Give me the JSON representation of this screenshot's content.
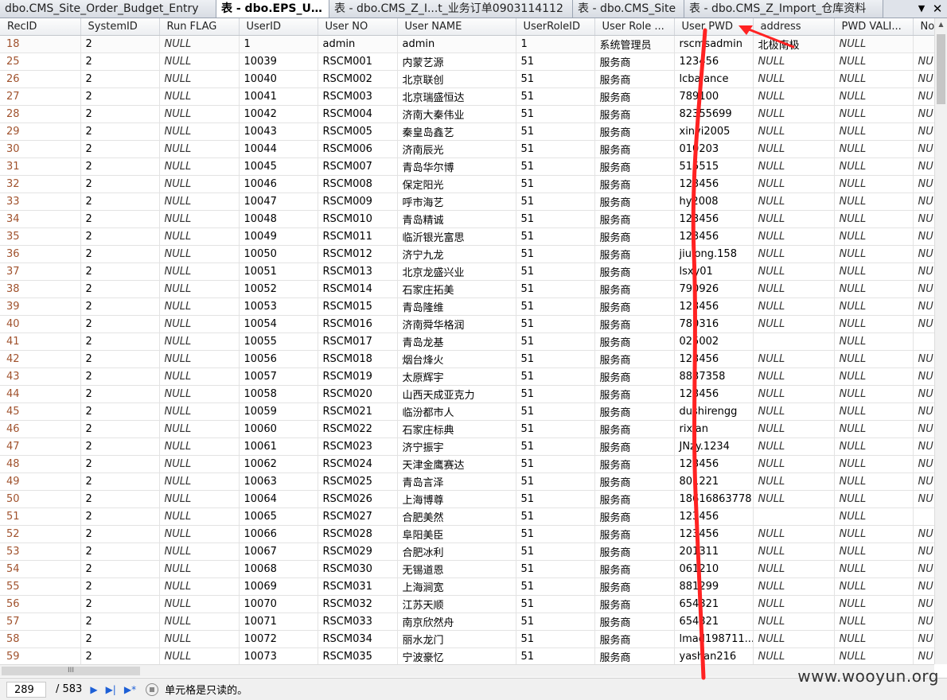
{
  "tabs": [
    {
      "label": "dbo.CMS_Site_Order_Budget_Entry"
    },
    {
      "label": "表 - dbo.EPS_User"
    },
    {
      "label": "表 - dbo.CMS_Z_I...t_业务订单0903114112"
    },
    {
      "label": "表 - dbo.CMS_Site"
    },
    {
      "label": "表 - dbo.CMS_Z_Import_仓库资料"
    }
  ],
  "tab_menu_icon": "▼",
  "tab_close_icon": "✕",
  "columns": [
    "RecID",
    "SystemID",
    "Run  FLAG",
    "UserID",
    "User  NO",
    "User  NAME",
    "UserRoleID",
    "User  Role  ...",
    "User  PWD",
    "address",
    "PWD  VALI...",
    "No"
  ],
  "rows": [
    [
      "18",
      "2",
      "NULL",
      "1",
      "admin",
      "admin",
      "1",
      "系统管理员",
      "rscmsadmin",
      "北极南极",
      "NULL",
      ""
    ],
    [
      "25",
      "2",
      "NULL",
      "10039",
      "RSCM001",
      "内蒙艺源",
      "51",
      "服务商",
      "123456",
      "NULL",
      "NULL",
      "NU"
    ],
    [
      "26",
      "2",
      "NULL",
      "10040",
      "RSCM002",
      "北京联创",
      "51",
      "服务商",
      "lcbalance",
      "NULL",
      "NULL",
      "NU"
    ],
    [
      "27",
      "2",
      "NULL",
      "10041",
      "RSCM003",
      "北京瑞盛恒达",
      "51",
      "服务商",
      "789100",
      "NULL",
      "NULL",
      "NU"
    ],
    [
      "28",
      "2",
      "NULL",
      "10042",
      "RSCM004",
      "济南大秦伟业",
      "51",
      "服务商",
      "82355699",
      "NULL",
      "NULL",
      "NU"
    ],
    [
      "29",
      "2",
      "NULL",
      "10043",
      "RSCM005",
      "秦皇岛鑫艺",
      "51",
      "服务商",
      "xinyi2005",
      "NULL",
      "NULL",
      "NU"
    ],
    [
      "30",
      "2",
      "NULL",
      "10044",
      "RSCM006",
      "济南辰光",
      "51",
      "服务商",
      "010203",
      "NULL",
      "NULL",
      "NU"
    ],
    [
      "31",
      "2",
      "NULL",
      "10045",
      "RSCM007",
      "青岛华尔博",
      "51",
      "服务商",
      "515515",
      "NULL",
      "NULL",
      "NU"
    ],
    [
      "32",
      "2",
      "NULL",
      "10046",
      "RSCM008",
      "保定阳光",
      "51",
      "服务商",
      "123456",
      "NULL",
      "NULL",
      "NU"
    ],
    [
      "33",
      "2",
      "NULL",
      "10047",
      "RSCM009",
      "呼市海艺",
      "51",
      "服务商",
      "hy2008",
      "NULL",
      "NULL",
      "NU"
    ],
    [
      "34",
      "2",
      "NULL",
      "10048",
      "RSCM010",
      "青岛精诚",
      "51",
      "服务商",
      "123456",
      "NULL",
      "NULL",
      "NU"
    ],
    [
      "35",
      "2",
      "NULL",
      "10049",
      "RSCM011",
      "临沂银光富思",
      "51",
      "服务商",
      "123456",
      "NULL",
      "NULL",
      "NU"
    ],
    [
      "36",
      "2",
      "NULL",
      "10050",
      "RSCM012",
      "济宁九龙",
      "51",
      "服务商",
      "jiulong.158",
      "NULL",
      "NULL",
      "NU"
    ],
    [
      "37",
      "2",
      "NULL",
      "10051",
      "RSCM013",
      "北京龙盛兴业",
      "51",
      "服务商",
      "lsxy01",
      "NULL",
      "NULL",
      "NU"
    ],
    [
      "38",
      "2",
      "NULL",
      "10052",
      "RSCM014",
      "石家庄拓美",
      "51",
      "服务商",
      "790926",
      "NULL",
      "NULL",
      "NU"
    ],
    [
      "39",
      "2",
      "NULL",
      "10053",
      "RSCM015",
      "青岛隆维",
      "51",
      "服务商",
      "123456",
      "NULL",
      "NULL",
      "NU"
    ],
    [
      "40",
      "2",
      "NULL",
      "10054",
      "RSCM016",
      "济南舜华格润",
      "51",
      "服务商",
      "780316",
      "NULL",
      "NULL",
      "NU"
    ],
    [
      "41",
      "2",
      "NULL",
      "10055",
      "RSCM017",
      "青岛龙基",
      "51",
      "服务商",
      "025002",
      "",
      "NULL",
      ""
    ],
    [
      "42",
      "2",
      "NULL",
      "10056",
      "RSCM018",
      "烟台烽火",
      "51",
      "服务商",
      "123456",
      "NULL",
      "NULL",
      "NU"
    ],
    [
      "43",
      "2",
      "NULL",
      "10057",
      "RSCM019",
      "太原辉宇",
      "51",
      "服务商",
      "8837358",
      "NULL",
      "NULL",
      "NU"
    ],
    [
      "44",
      "2",
      "NULL",
      "10058",
      "RSCM020",
      "山西天成亚克力",
      "51",
      "服务商",
      "123456",
      "NULL",
      "NULL",
      "NU"
    ],
    [
      "45",
      "2",
      "NULL",
      "10059",
      "RSCM021",
      "临汾都市人",
      "51",
      "服务商",
      "dushirengg",
      "NULL",
      "NULL",
      "NU"
    ],
    [
      "46",
      "2",
      "NULL",
      "10060",
      "RSCM022",
      "石家庄标典",
      "51",
      "服务商",
      "rixian",
      "NULL",
      "NULL",
      "NU"
    ],
    [
      "47",
      "2",
      "NULL",
      "10061",
      "RSCM023",
      "济宁振宇",
      "51",
      "服务商",
      "JNzy.1234",
      "NULL",
      "NULL",
      "NU"
    ],
    [
      "48",
      "2",
      "NULL",
      "10062",
      "RSCM024",
      "天津金鹰赛达",
      "51",
      "服务商",
      "123456",
      "NULL",
      "NULL",
      "NU"
    ],
    [
      "49",
      "2",
      "NULL",
      "10063",
      "RSCM025",
      "青岛言泽",
      "51",
      "服务商",
      "801221",
      "NULL",
      "NULL",
      "NU"
    ],
    [
      "50",
      "2",
      "NULL",
      "10064",
      "RSCM026",
      "上海博尊",
      "51",
      "服务商",
      "18616863778",
      "NULL",
      "NULL",
      "NU"
    ],
    [
      "51",
      "2",
      "NULL",
      "10065",
      "RSCM027",
      "合肥美然",
      "51",
      "服务商",
      "123456",
      "",
      "NULL",
      ""
    ],
    [
      "52",
      "2",
      "NULL",
      "10066",
      "RSCM028",
      "阜阳美臣",
      "51",
      "服务商",
      "123456",
      "NULL",
      "NULL",
      "NU"
    ],
    [
      "53",
      "2",
      "NULL",
      "10067",
      "RSCM029",
      "合肥冰利",
      "51",
      "服务商",
      "201311",
      "NULL",
      "NULL",
      "NU"
    ],
    [
      "54",
      "2",
      "NULL",
      "10068",
      "RSCM030",
      "无锡道恩",
      "51",
      "服务商",
      "061210",
      "NULL",
      "NULL",
      "NU"
    ],
    [
      "55",
      "2",
      "NULL",
      "10069",
      "RSCM031",
      "上海涧宽",
      "51",
      "服务商",
      "881299",
      "NULL",
      "NULL",
      "NU"
    ],
    [
      "56",
      "2",
      "NULL",
      "10070",
      "RSCM032",
      "江苏天顺",
      "51",
      "服务商",
      "654321",
      "NULL",
      "NULL",
      "NU"
    ],
    [
      "57",
      "2",
      "NULL",
      "10071",
      "RSCM033",
      "南京欣然舟",
      "51",
      "服务商",
      "654321",
      "NULL",
      "NULL",
      "NU"
    ],
    [
      "58",
      "2",
      "NULL",
      "10072",
      "RSCM034",
      "丽水龙门",
      "51",
      "服务商",
      "lmad198711...",
      "NULL",
      "NULL",
      "NU"
    ],
    [
      "59",
      "2",
      "NULL",
      "10073",
      "RSCM035",
      "宁波豪忆",
      "51",
      "服务商",
      "yashan216",
      "NULL",
      "NULL",
      "NU"
    ]
  ],
  "hscroll_grip": "III",
  "status": {
    "current_row": "289",
    "total_rows": "/ 583",
    "next_icon": "▶",
    "last_icon": "▶|",
    "new_icon": "▶*",
    "message": "单元格是只读的。"
  },
  "watermark": "www.wooyun.org",
  "annotation_color": "#ff2222"
}
